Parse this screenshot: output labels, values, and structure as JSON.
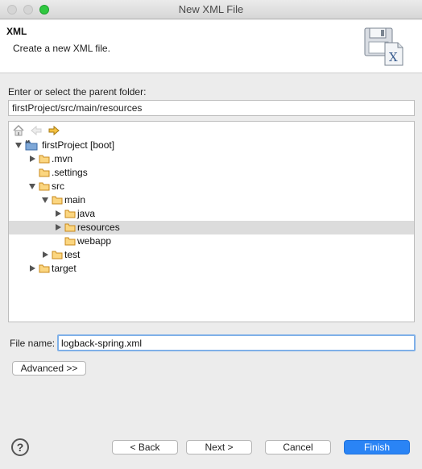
{
  "window": {
    "title": "New XML File"
  },
  "header": {
    "title": "XML",
    "description": "Create a new XML file."
  },
  "parent_folder": {
    "label": "Enter or select the parent folder:",
    "value": "firstProject/src/main/resources"
  },
  "tree": {
    "toolbar": [
      "home-icon",
      "back-arrow-icon",
      "forward-arrow-icon"
    ],
    "items": [
      {
        "label": "firstProject [boot]",
        "selected": false
      },
      {
        "label": ".mvn",
        "selected": false
      },
      {
        "label": ".settings",
        "selected": false
      },
      {
        "label": "src",
        "selected": false
      },
      {
        "label": "main",
        "selected": false
      },
      {
        "label": "java",
        "selected": false
      },
      {
        "label": "resources",
        "selected": true
      },
      {
        "label": "webapp",
        "selected": false
      },
      {
        "label": "test",
        "selected": false
      },
      {
        "label": "target",
        "selected": false
      }
    ]
  },
  "file_name": {
    "label": "File name:",
    "value": "logback-spring.xml"
  },
  "buttons": {
    "advanced": "Advanced >>",
    "back": "< Back",
    "next": "Next >",
    "cancel": "Cancel",
    "finish": "Finish",
    "help": "?"
  },
  "colors": {
    "accent": "#2a84f5",
    "folder": "#f3b73a",
    "selection": "#dcdcdc"
  }
}
